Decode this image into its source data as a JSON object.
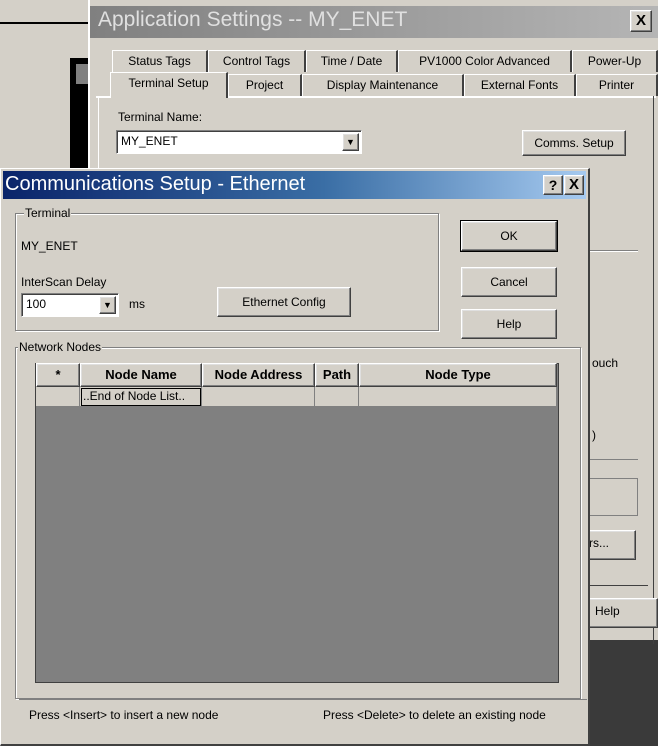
{
  "app_settings": {
    "title": "Application Settings -- MY_ENET",
    "close_label": "X",
    "tabs_row1": [
      "Status Tags",
      "Control Tags",
      "Time / Date",
      "PV1000 Color Advanced",
      "Power-Up"
    ],
    "tabs_row2": [
      "Terminal Setup",
      "Project",
      "Display Maintenance",
      "External Fonts",
      "Printer"
    ],
    "active_tab": "Terminal Setup",
    "terminal_name_label": "Terminal Name:",
    "terminal_name_value": "MY_ENET",
    "comms_setup_button": "Comms. Setup",
    "partial_touch_text": "ouch",
    "partial_paren": ")",
    "partial_button_text": "rs...",
    "help_button": "Help"
  },
  "comms_dialog": {
    "title": "Communications Setup - Ethernet",
    "help_icon_label": "?",
    "close_icon_label": "X",
    "terminal_group_label": "Terminal",
    "terminal_value": "MY_ENET",
    "interscan_label": "InterScan Delay",
    "interscan_value": "100",
    "interscan_unit": "ms",
    "ethernet_config_button": "Ethernet Config",
    "ok_button": "OK",
    "cancel_button": "Cancel",
    "help_button": "Help",
    "network_nodes_label": "Network Nodes",
    "grid": {
      "columns": [
        "*",
        "Node Name",
        "Node Address",
        "Path",
        "Node Type"
      ],
      "rows": [
        [
          "",
          "..End of Node List..",
          "",
          "",
          ""
        ]
      ]
    },
    "status_left": "Press <Insert> to insert a new node",
    "status_right": "Press <Delete> to delete an existing node"
  }
}
